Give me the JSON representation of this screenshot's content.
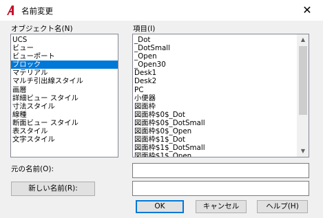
{
  "window": {
    "title": "名前変更",
    "close_glyph": "✕"
  },
  "object_names": {
    "label": "オブジェクト名(N)",
    "items": [
      "UCS",
      "ビュー",
      "ビューポート",
      "ブロック",
      "マテリアル",
      "マルチ引出線スタイル",
      "画層",
      "詳細ビュー スタイル",
      "寸法スタイル",
      "線種",
      "断面ビュー スタイル",
      "表スタイル",
      "文字スタイル"
    ],
    "selected_index": 3
  },
  "items_list": {
    "label": "項目(I)",
    "items": [
      "_Dot",
      "_DotSmall",
      "_Open",
      "_Open30",
      "Desk1",
      "Desk2",
      "PC",
      "小便器",
      "図面枠",
      "図面枠$0$_Dot",
      "図面枠$0$_DotSmall",
      "図面枠$0$_Open",
      "図面枠$1$_Dot",
      "図面枠$1$_DotSmall",
      "図面枠$1$_Open"
    ]
  },
  "old_name": {
    "label": "元の名前(O):",
    "value": ""
  },
  "new_name": {
    "button_label": "新しい名前(R):",
    "value": ""
  },
  "buttons": {
    "ok": "OK",
    "cancel": "キャンセル",
    "help": "ヘルプ(H)"
  },
  "colors": {
    "selection": "#0078d7",
    "app_icon": "#c8102e"
  }
}
